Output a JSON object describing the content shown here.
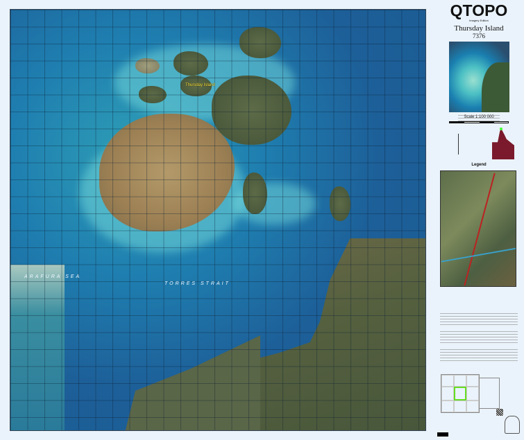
{
  "panel": {
    "title": "QTOPO",
    "edition": "Imagery Edition",
    "sheet_name": "Thursday Island",
    "sheet_number": "7376",
    "scale": "Scale 1:100 000",
    "legend": "Legend"
  },
  "map": {
    "labels": {
      "torres_strait": "TORRES STRAIT",
      "arafura_sea": "ARAFURA SEA",
      "thursday_island": "Thursday Island"
    }
  },
  "colors": {
    "queensland": "#7a1a2c",
    "sea": "#1d5f98"
  }
}
